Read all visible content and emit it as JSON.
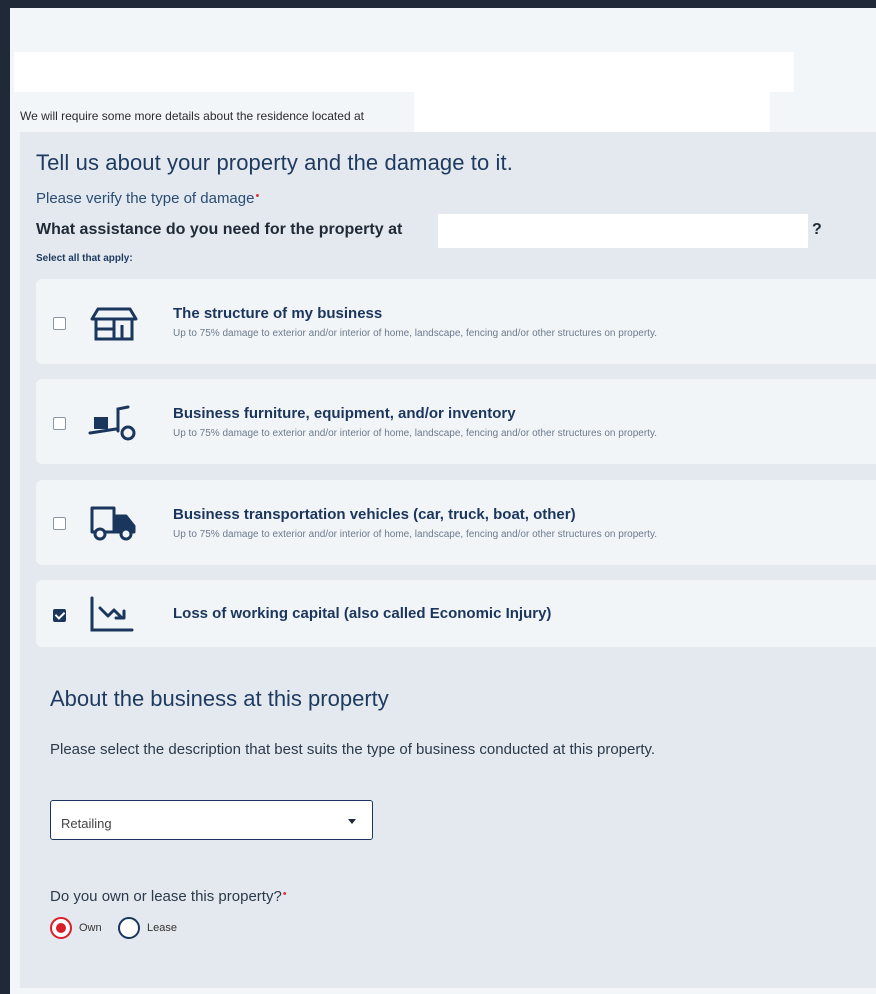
{
  "intro_text": "We will require some more details about the residence located at",
  "section": {
    "title": "Tell us about your property and the damage to it.",
    "verify_label": "Please verify the type of damage",
    "required_mark": "•",
    "question": "What assistance do you need for the property at",
    "question_end": "?",
    "hint": "Select all that apply:"
  },
  "options": [
    {
      "title": "The structure of my business",
      "desc": "Up to 75% damage to exterior and/or interior of home, landscape, fencing and/or other structures on property.",
      "checked": false,
      "icon": "storefront-icon"
    },
    {
      "title": "Business furniture, equipment, and/or inventory",
      "desc": "Up to 75% damage to exterior and/or interior of home, landscape, fencing and/or other structures on property.",
      "checked": false,
      "icon": "hand-truck-icon"
    },
    {
      "title": "Business transportation vehicles (car, truck, boat, other)",
      "desc": "Up to 75% damage to exterior and/or interior of home, landscape, fencing and/or other structures on property.",
      "checked": false,
      "icon": "truck-icon"
    },
    {
      "title": "Loss of working capital (also called Economic Injury)",
      "desc": "",
      "checked": true,
      "icon": "trend-down-chart-icon"
    }
  ],
  "business": {
    "title": "About the business at this property",
    "description": "Please select the description that best suits the type of business conducted at this property.",
    "select_value": "Retailing",
    "own_question": "Do you own or lease this property?",
    "radio_own": "Own",
    "radio_lease": "Lease",
    "selected": "Own"
  },
  "colors": {
    "navy": "#1b365d",
    "accent_red": "#d61f2a",
    "panel_bg": "#e4e9ef"
  }
}
